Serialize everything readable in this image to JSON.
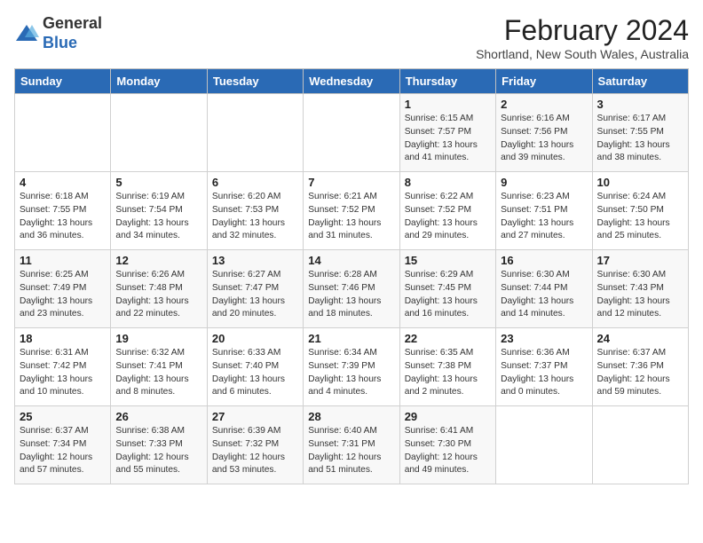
{
  "header": {
    "logo_general": "General",
    "logo_blue": "Blue",
    "month_year": "February 2024",
    "location": "Shortland, New South Wales, Australia"
  },
  "days_of_week": [
    "Sunday",
    "Monday",
    "Tuesday",
    "Wednesday",
    "Thursday",
    "Friday",
    "Saturday"
  ],
  "weeks": [
    [
      {
        "day": "",
        "info": ""
      },
      {
        "day": "",
        "info": ""
      },
      {
        "day": "",
        "info": ""
      },
      {
        "day": "",
        "info": ""
      },
      {
        "day": "1",
        "info": "Sunrise: 6:15 AM\nSunset: 7:57 PM\nDaylight: 13 hours\nand 41 minutes."
      },
      {
        "day": "2",
        "info": "Sunrise: 6:16 AM\nSunset: 7:56 PM\nDaylight: 13 hours\nand 39 minutes."
      },
      {
        "day": "3",
        "info": "Sunrise: 6:17 AM\nSunset: 7:55 PM\nDaylight: 13 hours\nand 38 minutes."
      }
    ],
    [
      {
        "day": "4",
        "info": "Sunrise: 6:18 AM\nSunset: 7:55 PM\nDaylight: 13 hours\nand 36 minutes."
      },
      {
        "day": "5",
        "info": "Sunrise: 6:19 AM\nSunset: 7:54 PM\nDaylight: 13 hours\nand 34 minutes."
      },
      {
        "day": "6",
        "info": "Sunrise: 6:20 AM\nSunset: 7:53 PM\nDaylight: 13 hours\nand 32 minutes."
      },
      {
        "day": "7",
        "info": "Sunrise: 6:21 AM\nSunset: 7:52 PM\nDaylight: 13 hours\nand 31 minutes."
      },
      {
        "day": "8",
        "info": "Sunrise: 6:22 AM\nSunset: 7:52 PM\nDaylight: 13 hours\nand 29 minutes."
      },
      {
        "day": "9",
        "info": "Sunrise: 6:23 AM\nSunset: 7:51 PM\nDaylight: 13 hours\nand 27 minutes."
      },
      {
        "day": "10",
        "info": "Sunrise: 6:24 AM\nSunset: 7:50 PM\nDaylight: 13 hours\nand 25 minutes."
      }
    ],
    [
      {
        "day": "11",
        "info": "Sunrise: 6:25 AM\nSunset: 7:49 PM\nDaylight: 13 hours\nand 23 minutes."
      },
      {
        "day": "12",
        "info": "Sunrise: 6:26 AM\nSunset: 7:48 PM\nDaylight: 13 hours\nand 22 minutes."
      },
      {
        "day": "13",
        "info": "Sunrise: 6:27 AM\nSunset: 7:47 PM\nDaylight: 13 hours\nand 20 minutes."
      },
      {
        "day": "14",
        "info": "Sunrise: 6:28 AM\nSunset: 7:46 PM\nDaylight: 13 hours\nand 18 minutes."
      },
      {
        "day": "15",
        "info": "Sunrise: 6:29 AM\nSunset: 7:45 PM\nDaylight: 13 hours\nand 16 minutes."
      },
      {
        "day": "16",
        "info": "Sunrise: 6:30 AM\nSunset: 7:44 PM\nDaylight: 13 hours\nand 14 minutes."
      },
      {
        "day": "17",
        "info": "Sunrise: 6:30 AM\nSunset: 7:43 PM\nDaylight: 13 hours\nand 12 minutes."
      }
    ],
    [
      {
        "day": "18",
        "info": "Sunrise: 6:31 AM\nSunset: 7:42 PM\nDaylight: 13 hours\nand 10 minutes."
      },
      {
        "day": "19",
        "info": "Sunrise: 6:32 AM\nSunset: 7:41 PM\nDaylight: 13 hours\nand 8 minutes."
      },
      {
        "day": "20",
        "info": "Sunrise: 6:33 AM\nSunset: 7:40 PM\nDaylight: 13 hours\nand 6 minutes."
      },
      {
        "day": "21",
        "info": "Sunrise: 6:34 AM\nSunset: 7:39 PM\nDaylight: 13 hours\nand 4 minutes."
      },
      {
        "day": "22",
        "info": "Sunrise: 6:35 AM\nSunset: 7:38 PM\nDaylight: 13 hours\nand 2 minutes."
      },
      {
        "day": "23",
        "info": "Sunrise: 6:36 AM\nSunset: 7:37 PM\nDaylight: 13 hours\nand 0 minutes."
      },
      {
        "day": "24",
        "info": "Sunrise: 6:37 AM\nSunset: 7:36 PM\nDaylight: 12 hours\nand 59 minutes."
      }
    ],
    [
      {
        "day": "25",
        "info": "Sunrise: 6:37 AM\nSunset: 7:34 PM\nDaylight: 12 hours\nand 57 minutes."
      },
      {
        "day": "26",
        "info": "Sunrise: 6:38 AM\nSunset: 7:33 PM\nDaylight: 12 hours\nand 55 minutes."
      },
      {
        "day": "27",
        "info": "Sunrise: 6:39 AM\nSunset: 7:32 PM\nDaylight: 12 hours\nand 53 minutes."
      },
      {
        "day": "28",
        "info": "Sunrise: 6:40 AM\nSunset: 7:31 PM\nDaylight: 12 hours\nand 51 minutes."
      },
      {
        "day": "29",
        "info": "Sunrise: 6:41 AM\nSunset: 7:30 PM\nDaylight: 12 hours\nand 49 minutes."
      },
      {
        "day": "",
        "info": ""
      },
      {
        "day": "",
        "info": ""
      }
    ]
  ]
}
